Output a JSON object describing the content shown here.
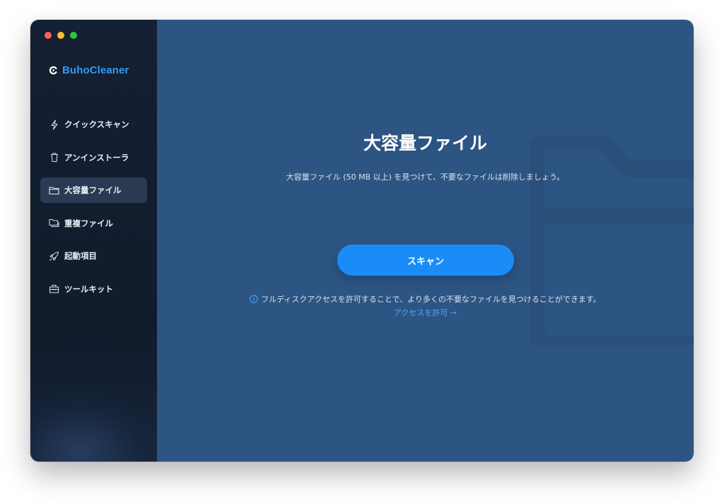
{
  "window": {
    "traffic_lights": [
      "#ff5f57",
      "#febc2e",
      "#28c840"
    ]
  },
  "sidebar": {
    "app_name": "BuhoCleaner",
    "brand_color": "#2f9bf2",
    "items": [
      {
        "label": "クイックスキャン",
        "icon": "lightning-icon",
        "active": false
      },
      {
        "label": "アンインストーラ",
        "icon": "trash-icon",
        "active": false
      },
      {
        "label": "大容量ファイル",
        "icon": "folder-icon",
        "active": true
      },
      {
        "label": "重複ファイル",
        "icon": "duplicate-folder-icon",
        "active": false
      },
      {
        "label": "起動項目",
        "icon": "rocket-icon",
        "active": false
      },
      {
        "label": "ツールキット",
        "icon": "toolbox-icon",
        "active": false
      }
    ]
  },
  "main": {
    "title": "大容量ファイル",
    "subtitle": "大容量ファイル (50 MB 以上) を見つけて、不要なファイルは削除しましょう。",
    "scan_button": "スキャン",
    "notice": "フルディスクアクセスを許可することで、より多くの不要なファイルを見つけることができます。",
    "access_link": "アクセスを許可 →",
    "background_icon": "folder-icon",
    "accent_color": "#1a8cf7",
    "background_color": "#2d5583"
  }
}
